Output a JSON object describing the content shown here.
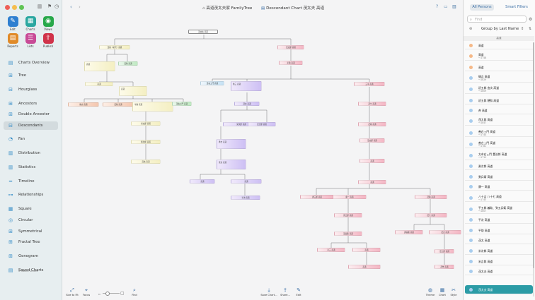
{
  "window": {
    "title": "高道茂太夫家 FamilyTree",
    "chart_title": "Descendant Chart 茂太夫 高道"
  },
  "toolbar": {
    "edit": "Edit",
    "charts": "Charts",
    "views": "Views",
    "reports": "Reports",
    "lists": "Lists",
    "publish": "Publish"
  },
  "nav": [
    {
      "label": "Charts Overview",
      "color": "#3a8fc7"
    },
    {
      "label": "Tree",
      "color": "#3a8fc7"
    },
    {
      "label": "Hourglass",
      "color": "#3a8fc7"
    },
    {
      "label": "Ancestors",
      "color": "#3a8fc7"
    },
    {
      "label": "Double Ancestor",
      "color": "#3a8fc7"
    },
    {
      "label": "Descendants",
      "color": "#3a8fc7"
    },
    {
      "label": "Fan",
      "color": "#3a8fc7"
    },
    {
      "label": "Distribution",
      "color": "#3a8fc7"
    },
    {
      "label": "Statistics",
      "color": "#3a8fc7"
    },
    {
      "label": "Timeline",
      "color": "#3a8fc7"
    },
    {
      "label": "Relationships",
      "color": "#3a8fc7"
    },
    {
      "label": "Square",
      "color": "#3a8fc7"
    },
    {
      "label": "Circular",
      "color": "#3a8fc7"
    },
    {
      "label": "Symmetrical",
      "color": "#3a8fc7"
    },
    {
      "label": "Fractal Tree",
      "color": "#3a8fc7"
    },
    {
      "label": "Genogram",
      "color": "#3a8fc7"
    },
    {
      "label": "Saved Charts",
      "color": "#3a8fc7"
    }
  ],
  "saved_sub": "0 Saved Charts",
  "bottom": {
    "size_to_fit": "Size to Fit",
    "focus": "Focus",
    "find": "Find",
    "save_chart": "Save Chart...",
    "share": "Share...",
    "edit": "Edit",
    "theme": "Theme",
    "chart": "Chart",
    "style": "Style"
  },
  "right": {
    "tab_all": "All Persons",
    "tab_smart": "Smart Filters",
    "find_placeholder": "Find",
    "group_by": "Group by Last Name",
    "section": "高道",
    "persons": [
      {
        "name": "高道",
        "date": "",
        "color": "#f5b887"
      },
      {
        "name": "高道",
        "date": "～1748",
        "color": "#f5b887"
      },
      {
        "name": "高道",
        "date": "",
        "color": "#f5b887"
      },
      {
        "name": "篠吉 高道",
        "date": "～1829",
        "color": "#a8cdee"
      },
      {
        "name": "初五郎 由次 高道",
        "date": "～1809",
        "color": "#a8cdee"
      },
      {
        "name": "初五郎 穂和 高道",
        "date": "",
        "color": "#a8cdee"
      },
      {
        "name": "斉 高道",
        "date": "",
        "color": "#a8cdee"
      },
      {
        "name": "茂太郎 高道",
        "date": "～1847",
        "color": "#a8cdee"
      },
      {
        "name": "善右ェ門 高道",
        "date": "～1744",
        "color": "#a8cdee"
      },
      {
        "name": "善左ェ門 高道",
        "date": "～1781",
        "color": "#a8cdee"
      },
      {
        "name": "太市右ェ門 豊治郎 高道",
        "date": "～1710",
        "color": "#a8cdee"
      },
      {
        "name": "勇次郎 高道",
        "date": "",
        "color": "#a8cdee"
      },
      {
        "name": "勇兵衛 高道",
        "date": "",
        "color": "#a8cdee"
      },
      {
        "name": "康一 高道",
        "date": "",
        "color": "#a8cdee"
      },
      {
        "name": "八十吉 八十七 高道",
        "date": "～1743",
        "color": "#a8cdee"
      },
      {
        "name": "平五郎 義助、弥五兵衛 高道",
        "date": "～1807",
        "color": "#a8cdee"
      },
      {
        "name": "平次 高道",
        "date": "",
        "color": "#a8cdee"
      },
      {
        "name": "平助 高道",
        "date": "",
        "color": "#a8cdee"
      },
      {
        "name": "茂太 高道",
        "date": "",
        "color": "#a8cdee"
      },
      {
        "name": "米次郎 高道",
        "date": "",
        "color": "#a8cdee"
      },
      {
        "name": "米吉郎 高道",
        "date": "",
        "color": "#a8cdee"
      },
      {
        "name": "茂太夫 高道",
        "date": "",
        "color": "#a8cdee"
      },
      {
        "name": "茂太夫 高道",
        "date": "",
        "color": "#a8cdee",
        "selected": true
      }
    ]
  },
  "tree": {
    "root": "茂太夫 高道",
    "n1": "茂助（初代）高道",
    "n2": "茂太郎 高道",
    "n3": "高道",
    "n4": "茂助 高道",
    "n5": "高道",
    "n6": "平助 高道",
    "n7": "高道",
    "n8": "茂右ェ門 高道",
    "n9": "勇三 高道",
    "n10": "三平 高道",
    "n11": "篠吉 高道",
    "n12": "茂助 高道",
    "n13": "平助 高道",
    "n14": "茂右ェ門 高道",
    "n15": "茂太 高道",
    "n16": "茂七 高道",
    "n17": "米太郎 高道",
    "n18": "米次郎 高道",
    "n19": "茂吉郎 高道",
    "n20": "茂助 高道",
    "n21": "勇次郎 高道",
    "n22": "勇吉 高道",
    "n23": "茂太郎 高道",
    "n24": "茂太 高道",
    "n25": "善次 高道",
    "n26": "高道",
    "n27": "高道",
    "n28": "高道",
    "n29": "高道",
    "n30": "平次 高道",
    "n31": "勇三郎 高道",
    "n32": "康一 高道",
    "n33": "茂助 高道",
    "n34": "善三郎 高道",
    "n35": "茂七 高道",
    "n36": "茂兵衛 高道",
    "n37": "勇兵衛 高道",
    "n38": "茂太 高道",
    "n39": "平三 高道",
    "n40": "高道",
    "n41": "茂五郎 高道",
    "n42": "高道",
    "n43": "茂作 高道",
    "n44": "茂市 高道",
    "n45": "茂吉 高道"
  }
}
